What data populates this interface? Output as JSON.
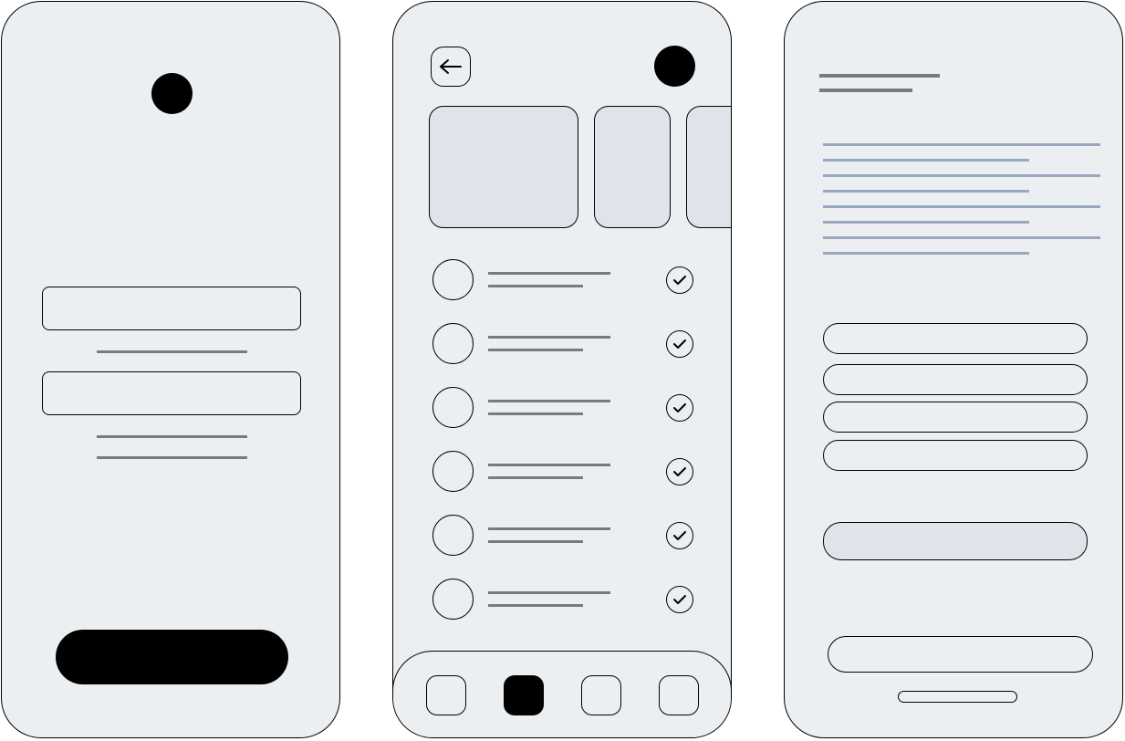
{
  "app": {
    "screens": [
      "login-screen",
      "list-screen",
      "detail-screen"
    ]
  },
  "colors": {
    "background": "#eceff2",
    "card_fill": "#e0e4ea",
    "text_placeholder_gray": "#7a7a7a",
    "text_placeholder_blue": "#9aa8bf",
    "stroke": "#000000"
  },
  "login": {
    "avatar": "profile-dot",
    "fields": [
      "username-field",
      "password-field"
    ],
    "primary_button": "sign-in-button"
  },
  "list": {
    "header": {
      "back_icon": "arrow-left-icon",
      "avatar": "profile-dot"
    },
    "carousel_cards": 3,
    "items": [
      {
        "status": "check-icon"
      },
      {
        "status": "check-icon"
      },
      {
        "status": "check-icon"
      },
      {
        "status": "check-icon"
      },
      {
        "status": "check-icon"
      },
      {
        "status": "check-icon"
      }
    ],
    "tabbar": {
      "tabs": [
        "tab-1",
        "tab-2",
        "tab-3",
        "tab-4"
      ],
      "active_index": 1
    }
  },
  "detail": {
    "options": [
      "option-1",
      "option-2",
      "option-3",
      "option-4"
    ],
    "secondary_action": "secondary-button",
    "bottom_action": "bottom-button"
  }
}
